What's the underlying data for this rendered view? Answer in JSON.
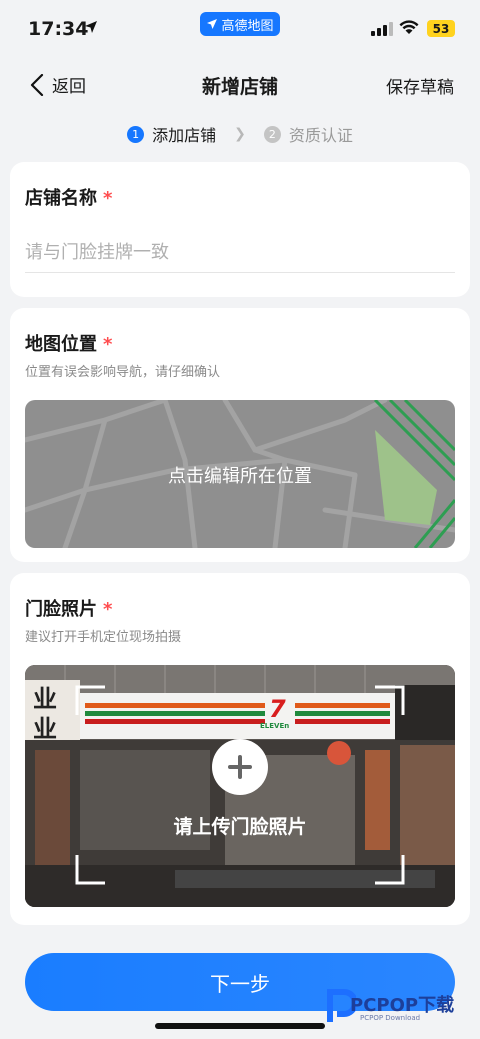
{
  "status_bar": {
    "time": "17:34",
    "app_pill_label": "高德地图",
    "battery": "53"
  },
  "nav": {
    "back_label": "返回",
    "title": "新增店铺",
    "save_draft": "保存草稿"
  },
  "steps": [
    {
      "number": "1",
      "label": "添加店铺",
      "active": true
    },
    {
      "number": "2",
      "label": "资质认证",
      "active": false
    }
  ],
  "store_name": {
    "title": "店铺名称",
    "required_mark": "*",
    "placeholder": "请与门脸挂牌一致",
    "value": ""
  },
  "map_location": {
    "title": "地图位置",
    "required_mark": "*",
    "hint": "位置有误会影响导航，请仔细确认",
    "edit_label": "点击编辑所在位置"
  },
  "storefront_photo": {
    "title": "门脸照片",
    "required_mark": "*",
    "hint": "建议打开手机定位现场拍摄",
    "upload_label": "请上传门脸照片",
    "sign_text_left_top": "业",
    "sign_text_left_bottom": "业",
    "sign_text_brand": "7",
    "sign_text_eleven": "ELEVEn"
  },
  "footer": {
    "next_label": "下一步"
  },
  "watermark": {
    "logo_text": "PCPOP下载",
    "sub_text": "PCPOP Download"
  },
  "colors": {
    "accent": "#1677ff",
    "required": "#ff4d4f",
    "background": "#f2f3f5"
  }
}
